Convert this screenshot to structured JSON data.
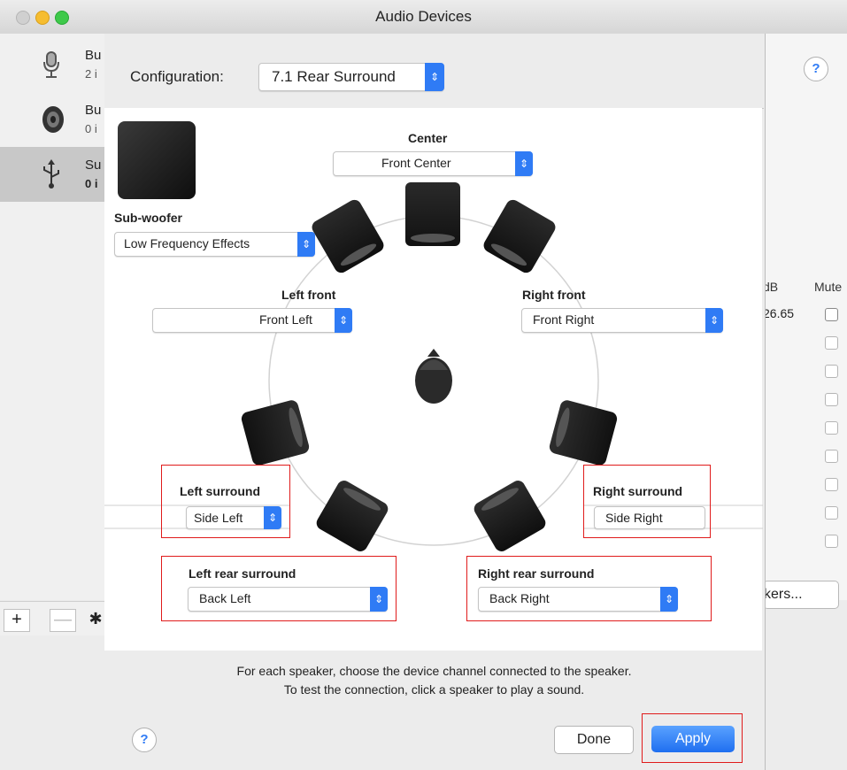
{
  "window": {
    "title": "Audio Devices"
  },
  "devices": [
    {
      "name": "Bu",
      "sub": "2 i",
      "icon": "microphone-icon"
    },
    {
      "name": "Bu",
      "sub": "0 i",
      "icon": "speaker-icon"
    },
    {
      "name": "Su",
      "sub": "0 i",
      "icon": "usb-icon"
    }
  ],
  "underlying": {
    "help": "?",
    "col_db": "dB",
    "col_mute": "Mute",
    "volume_value": "26.65",
    "speakers_button": "kers...",
    "add_label": "+",
    "remove_label": "—",
    "gear_label": "✱"
  },
  "config": {
    "label": "Configuration:",
    "value": "7.1 Rear Surround"
  },
  "speakers": {
    "subwoofer": {
      "label": "Sub-woofer",
      "channel": "Low Frequency Effects"
    },
    "center": {
      "label": "Center",
      "channel": "Front Center"
    },
    "left_front": {
      "label": "Left front",
      "channel": "Front Left"
    },
    "right_front": {
      "label": "Right front",
      "channel": "Front Right"
    },
    "left_surround": {
      "label": "Left surround",
      "channel": "Side Left"
    },
    "right_surround": {
      "label": "Right surround",
      "channel": "Side Right"
    },
    "left_rear_surround": {
      "label": "Left rear surround",
      "channel": "Back Left"
    },
    "right_rear_surround": {
      "label": "Right rear surround",
      "channel": "Back Right"
    }
  },
  "hint": {
    "line1": "For each speaker, choose the device channel connected to the speaker.",
    "line2": "To test the connection, click a speaker to play a sound."
  },
  "buttons": {
    "help": "?",
    "done": "Done",
    "apply": "Apply"
  },
  "colors": {
    "accent": "#2f7bf5",
    "highlight": "#e01b1b",
    "speaker": "#1c1c1c"
  }
}
